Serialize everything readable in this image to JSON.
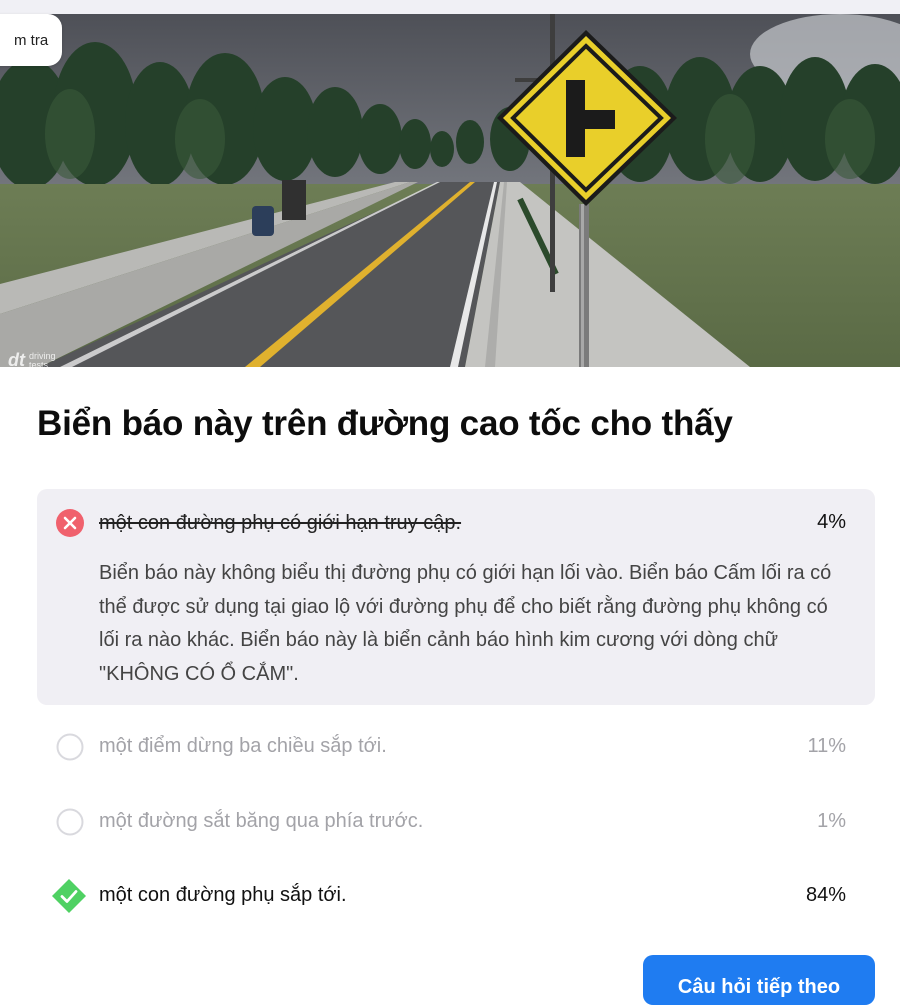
{
  "scene": {
    "badge_label": "m tra",
    "watermark_logo": "dt",
    "watermark_text_1": "driving",
    "watermark_text_2": "tests",
    "sign_name": "side-road-ahead-sign"
  },
  "question": {
    "title": "Biển báo này trên đường cao tốc cho thấy"
  },
  "options": [
    {
      "text": "một con đường phụ có giới hạn truy cập.",
      "percent": "4%",
      "state": "wrong",
      "explanation": "Biển báo này không biểu thị đường phụ có giới hạn lối vào. Biển báo Cấm lối ra có thể được sử dụng tại giao lộ với đường phụ để cho biết rằng đường phụ không có lối ra nào khác. Biển báo này là biển cảnh báo hình kim cương với dòng chữ \"KHÔNG CÓ Ổ CẮM\"."
    },
    {
      "text": "một điểm dừng ba chiều sắp tới.",
      "percent": "11%",
      "state": "unselected"
    },
    {
      "text": "một đường sắt băng qua phía trước.",
      "percent": "1%",
      "state": "unselected"
    },
    {
      "text": "một con đường phụ sắp tới.",
      "percent": "84%",
      "state": "correct"
    }
  ],
  "next_button": {
    "label": "Câu hỏi tiếp theo"
  },
  "colors": {
    "wrong": "#f0616d",
    "correct": "#4fd163",
    "primary": "#1f7cf1",
    "panel": "#f0eff4"
  }
}
